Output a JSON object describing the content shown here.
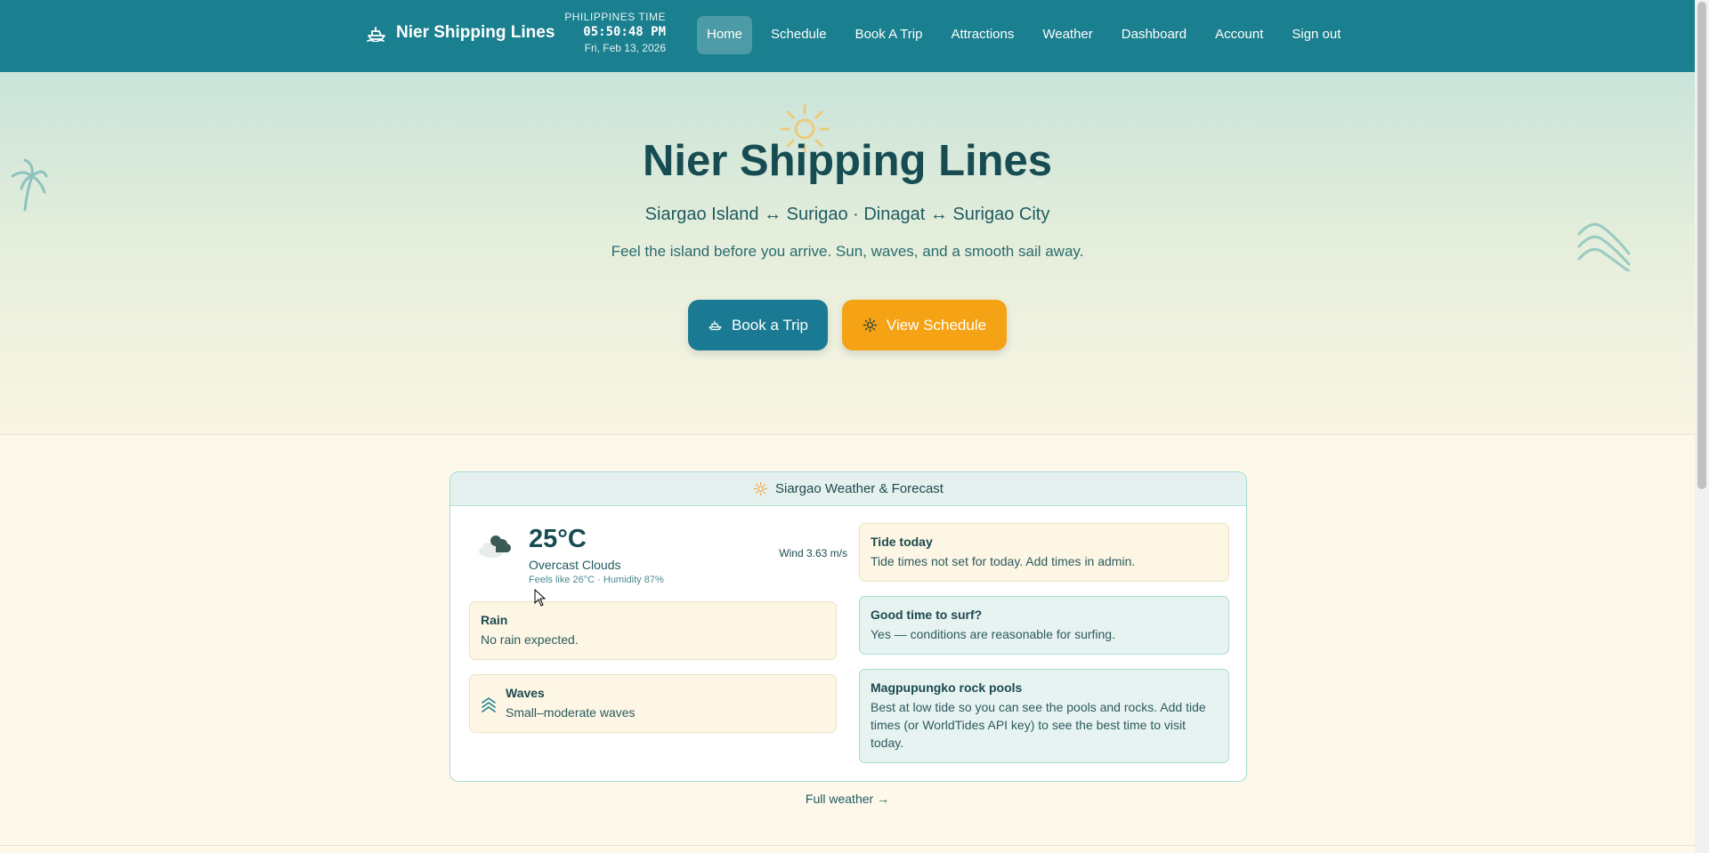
{
  "brand": {
    "name": "Nier Shipping Lines"
  },
  "clock": {
    "label": "PHILIPPINES TIME",
    "time": "05:50:48 PM",
    "date": "Fri, Feb 13, 2026"
  },
  "nav": {
    "items": [
      {
        "label": "Home",
        "active": true
      },
      {
        "label": "Schedule"
      },
      {
        "label": "Book A Trip"
      },
      {
        "label": "Attractions"
      },
      {
        "label": "Weather"
      },
      {
        "label": "Dashboard"
      },
      {
        "label": "Account"
      },
      {
        "label": "Sign out"
      }
    ]
  },
  "hero": {
    "title": "Nier Shipping Lines",
    "subtitle": "Siargao Island ↔ Surigao · Dinagat ↔ Surigao City",
    "tagline": "Feel the island before you arrive. Sun, waves, and a smooth sail away.",
    "book_label": "Book a Trip",
    "schedule_label": "View Schedule"
  },
  "weather": {
    "header": "Siargao Weather & Forecast",
    "temp": "25°C",
    "condition": "Overcast Clouds",
    "feels": "Feels like 26°C · Humidity 87%",
    "wind": "Wind 3.63 m/s",
    "rain": {
      "title": "Rain",
      "desc": "No rain expected."
    },
    "waves": {
      "title": "Waves",
      "desc": "Small–moderate waves"
    },
    "tide": {
      "title": "Tide today",
      "desc": "Tide times not set for today. Add times in admin."
    },
    "surf": {
      "title": "Good time to surf?",
      "desc": "Yes — conditions are reasonable for surfing."
    },
    "pools": {
      "title": "Magpupungko rock pools",
      "desc": "Best at low tide so you can see the pools and rocks. Add tide times (or WorldTides API key) to see the best time to visit today."
    },
    "full_link": "Full weather →"
  },
  "colors": {
    "nav": "#1a7f8e",
    "book": "#1a7a93",
    "schedule": "#f5a214",
    "sun": "#f5b942"
  }
}
